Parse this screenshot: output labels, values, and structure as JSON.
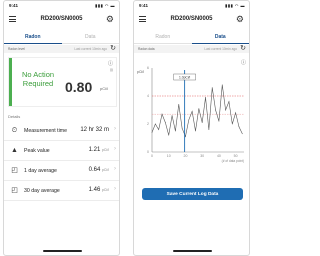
{
  "left": {
    "status_time": "9:41",
    "device_title": "RD200/SN0005",
    "tabs": [
      "Radon",
      "Data"
    ],
    "radon_level_label": "Radon level",
    "last_measure_note": "Last current 10min ago",
    "status_text": "No Action Required",
    "current_value": "0.80",
    "unit": "pCi/l",
    "details_label": "Details",
    "details": [
      {
        "icon": "timer-icon",
        "glyph": "⏲",
        "label": "Measurement time",
        "value": "12 hr 32 m",
        "unit": ""
      },
      {
        "icon": "peak-icon",
        "glyph": "▲",
        "label": "Peak value",
        "value": "1.21",
        "unit": "pCi/l"
      },
      {
        "icon": "day-chart-icon",
        "glyph": "◰",
        "label": "1 day average",
        "value": "0.64",
        "unit": "pCi/l"
      },
      {
        "icon": "month-chart-icon",
        "glyph": "◰",
        "label": "30 day average",
        "value": "1.46",
        "unit": "pCi/l"
      }
    ]
  },
  "right": {
    "status_time": "9:41",
    "device_title": "RD200/SN0005",
    "tabs": [
      "Radon",
      "Data"
    ],
    "radon_data_label": "Radon data",
    "last_measure_note": "Last current 10min ago",
    "save_button": "Save Current Log Data",
    "chart_data": {
      "type": "line",
      "ylabel": "pCi/l",
      "xlabel": "(# of data point)",
      "ylim": [
        0,
        6
      ],
      "y_ticks": [
        0,
        2,
        4,
        6
      ],
      "x_ticks": [
        0,
        10,
        20,
        30,
        40,
        50
      ],
      "threshold_lines": [
        4.0,
        2.7
      ],
      "cursor_label": "1.0pCi/l",
      "x": [
        0,
        2,
        4,
        6,
        8,
        10,
        12,
        14,
        16,
        18,
        20,
        22,
        24,
        26,
        28,
        30,
        32,
        34,
        36,
        38,
        40,
        42,
        44,
        46,
        48,
        50,
        52,
        54
      ],
      "values": [
        1.4,
        2.0,
        1.6,
        2.7,
        2.1,
        1.2,
        2.6,
        1.5,
        3.4,
        1.7,
        1.1,
        2.3,
        2.9,
        1.5,
        3.1,
        2.1,
        3.9,
        1.6,
        4.6,
        3.0,
        2.2,
        4.8,
        3.0,
        3.6,
        2.0,
        2.8,
        1.8,
        1.3
      ]
    }
  }
}
